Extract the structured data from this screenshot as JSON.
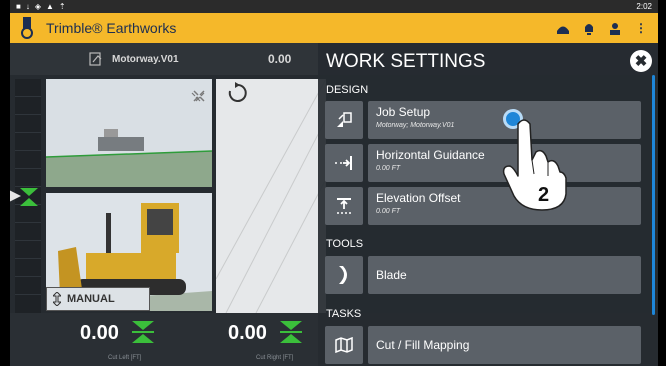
{
  "status_bar": {
    "time": "2:02"
  },
  "app_bar": {
    "title": "Trimble® Earthworks"
  },
  "top_info": {
    "design_name": "Motorway.V01",
    "value": "0.00"
  },
  "views": {
    "mode_label": "MANUAL"
  },
  "bottom": {
    "left_value": "0.00",
    "left_label": "Cut Left [FT]",
    "right_value": "0.00",
    "right_label": "Cut Right [FT]"
  },
  "work_settings": {
    "title": "WORK SETTINGS",
    "sections": {
      "design": "DESIGN",
      "tools": "TOOLS",
      "tasks": "TASKS"
    },
    "items": {
      "job_setup": {
        "name": "Job Setup",
        "detail": "Motorway; Motorway.V01"
      },
      "horizontal_guidance": {
        "name": "Horizontal Guidance",
        "detail": "0.00 FT"
      },
      "elevation_offset": {
        "name": "Elevation Offset",
        "detail": "0.00 FT"
      },
      "blade": {
        "name": "Blade"
      },
      "cut_fill": {
        "name": "Cut / Fill Mapping"
      }
    }
  },
  "annotation": {
    "step_number": "2"
  },
  "colors": {
    "appbar": "#f5b82a",
    "accent": "#1e86d8",
    "panel": "#262b30",
    "row": "#5b6168",
    "cut_green": "#3bbf3b"
  }
}
